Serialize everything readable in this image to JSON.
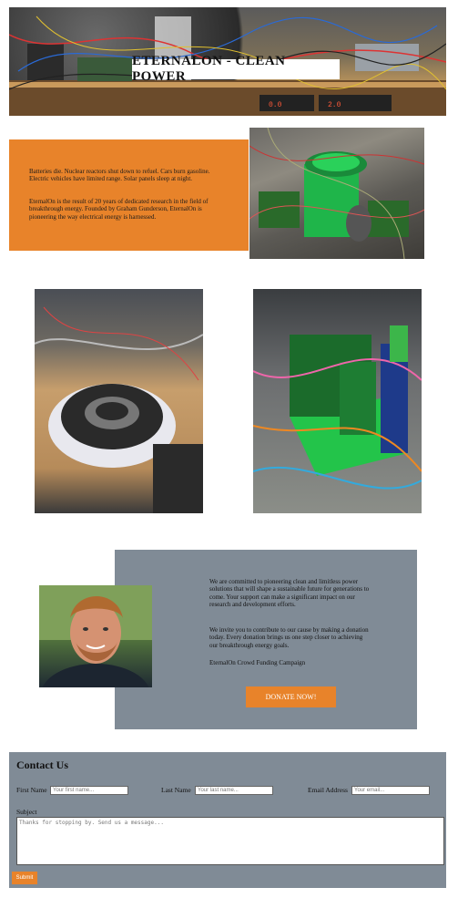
{
  "hero": {
    "title": "ETERNALON - CLEAN POWER"
  },
  "intro": {
    "paragraph1": "Batteries die. Nuclear reactors shut down to refuel. Cars burn gasoline. Electric vehicles have limited range. Solar panels sleep at night.",
    "paragraph2": "EternalOn is the result of 20 years of dedicated research in the field of breakthrough energy. Founded by Graham Gunderson, EternalOn is pioneering the way electrical energy is harnessed."
  },
  "mission": {
    "paragraph1": "We are committed to pioneering clean and limitless power solutions that will shape a sustainable future for generations to come. Your support can make a significant impact on our research and development efforts.",
    "paragraph2": "We invite you to contribute to our cause by making a donation today. Every donation brings us one step closer to achieving our breakthrough energy goals.",
    "paragraph3": "EternalOn Crowd Funding Campaign",
    "donate_label": "DONATE NOW!"
  },
  "contact": {
    "heading": "Contact Us",
    "first_name_label": "First Name",
    "first_name_placeholder": "Your first name...",
    "last_name_label": "Last Name",
    "last_name_placeholder": "Your last name...",
    "email_label": "Email Address",
    "email_placeholder": "Your email...",
    "subject_label": "Subject",
    "subject_placeholder": "Thanks for stopping by. Send us a message...",
    "submit_label": "Submit"
  },
  "colors": {
    "accent": "#e8832a",
    "panel": "#808b96"
  }
}
